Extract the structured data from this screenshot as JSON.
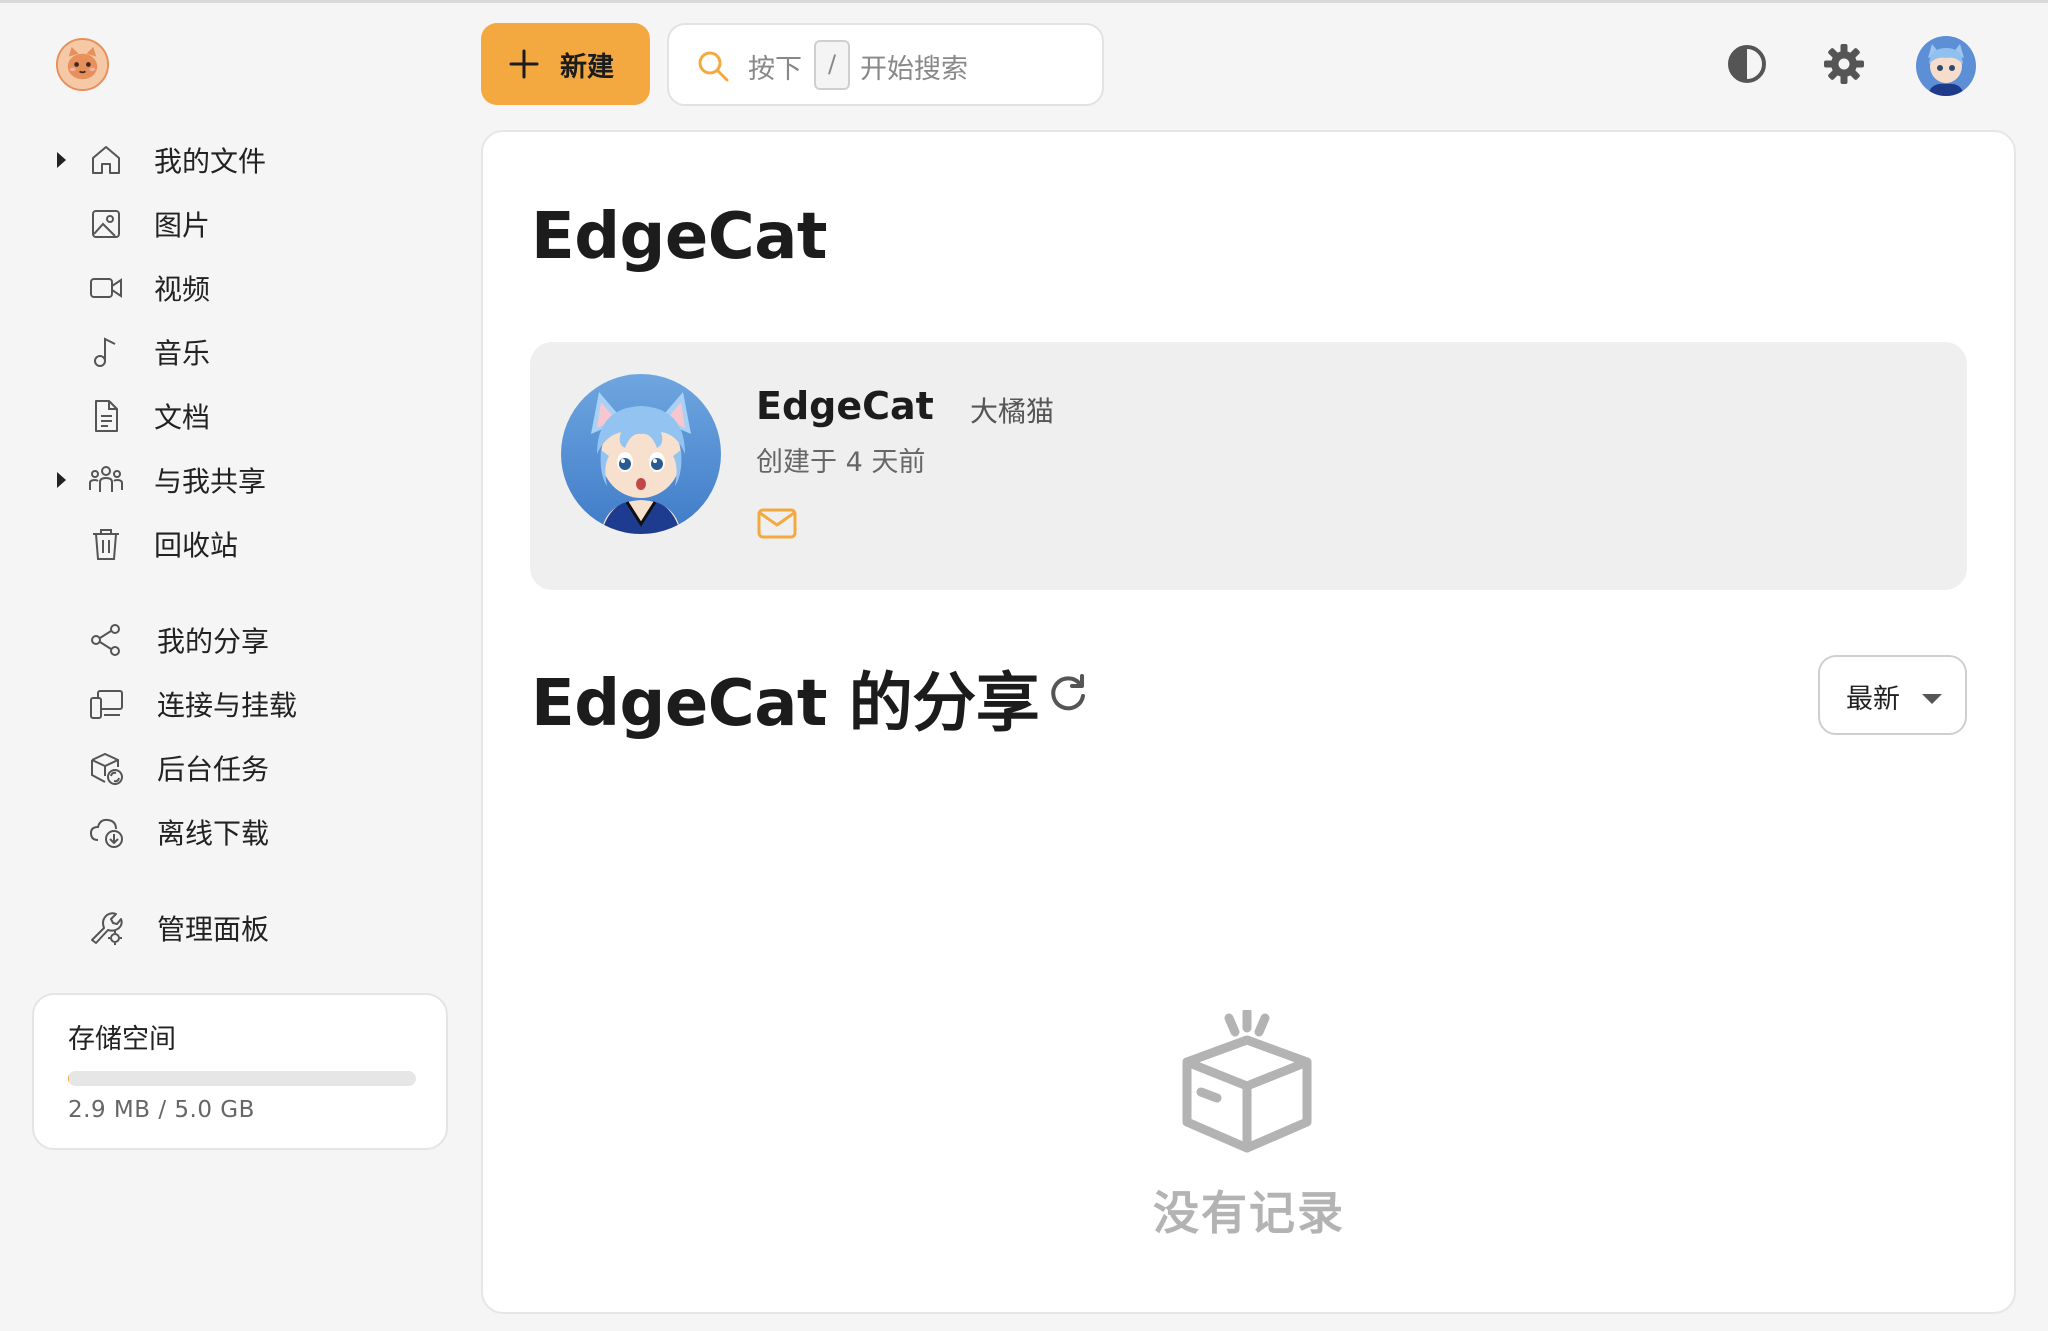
{
  "header": {
    "new_button_label": "新建",
    "search": {
      "prefix": "按下",
      "key": "/",
      "suffix": "开始搜索"
    }
  },
  "sidebar": {
    "items": [
      {
        "label": "我的文件",
        "icon": "home-icon",
        "expandable": true
      },
      {
        "label": "图片",
        "icon": "image-icon",
        "expandable": false
      },
      {
        "label": "视频",
        "icon": "video-icon",
        "expandable": false
      },
      {
        "label": "音乐",
        "icon": "music-icon",
        "expandable": false
      },
      {
        "label": "文档",
        "icon": "document-icon",
        "expandable": false
      },
      {
        "label": "与我共享",
        "icon": "people-icon",
        "expandable": true
      },
      {
        "label": "回收站",
        "icon": "trash-icon",
        "expandable": false
      }
    ],
    "items2": [
      {
        "label": "我的分享",
        "icon": "share-icon"
      },
      {
        "label": "连接与挂载",
        "icon": "devices-icon"
      },
      {
        "label": "后台任务",
        "icon": "box-sync-icon"
      },
      {
        "label": "离线下载",
        "icon": "cloud-download-icon"
      }
    ],
    "items3": [
      {
        "label": "管理面板",
        "icon": "wrench-gear-icon"
      }
    ],
    "storage": {
      "title": "存储空间",
      "usage": "2.9 MB / 5.0 GB",
      "fraction": 0.0006
    }
  },
  "main": {
    "title": "EdgeCat",
    "profile": {
      "name": "EdgeCat",
      "nickname": "大橘猫",
      "created": "创建于 4 天前"
    },
    "share_title": "EdgeCat 的分享",
    "sort_label": "最新",
    "empty_text": "没有记录"
  },
  "colors": {
    "accent": "#f3a93f",
    "background": "#f5f5f5"
  }
}
